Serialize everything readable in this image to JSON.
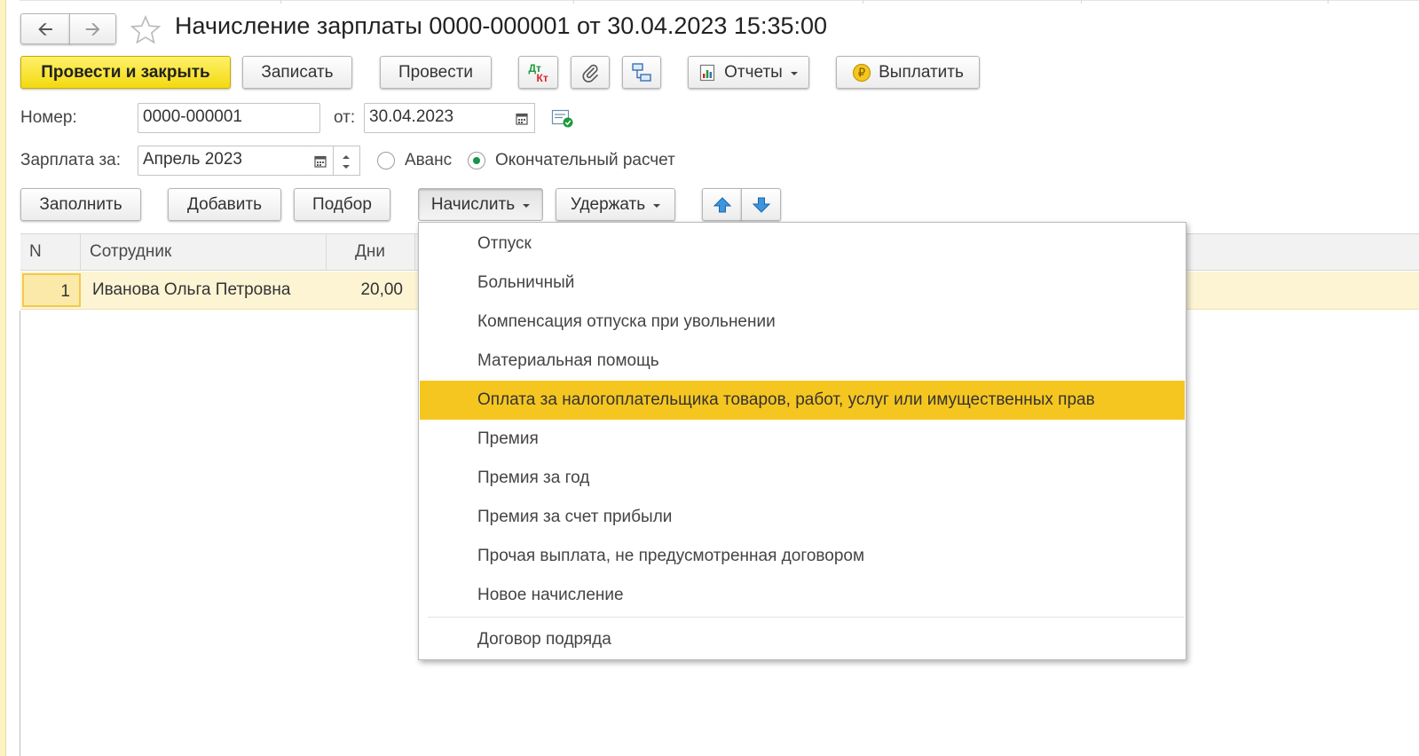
{
  "window": {
    "title": "Начисление зарплаты 0000-000001 от 30.04.2023 15:35:00"
  },
  "nav": {
    "back_icon": "arrow-left-icon",
    "forward_icon": "arrow-right-icon",
    "favorite_icon": "star-icon"
  },
  "toolbar": {
    "post_and_close": "Провести и закрыть",
    "save": "Записать",
    "post": "Провести",
    "dt_kt_top": "Дт",
    "dt_kt_bottom": "Кт",
    "attach_icon": "paperclip-icon",
    "structure_icon": "structure-icon",
    "reports": "Отчеты",
    "pay": "Выплатить"
  },
  "form": {
    "number_label": "Номер:",
    "number_value": "0000-000001",
    "date_label": "от:",
    "date_value": "30.04.2023",
    "salary_for_label": "Зарплата за:",
    "salary_for_value": "Апрель 2023",
    "radio_advance": "Аванс",
    "radio_final": "Окончательный расчет",
    "selected_radio": "Окончательный расчет"
  },
  "table_toolbar": {
    "fill": "Заполнить",
    "add": "Добавить",
    "pick": "Подбор",
    "accrue": "Начислить",
    "withhold": "Удержать"
  },
  "table": {
    "columns": [
      "N",
      "Сотрудник",
      "Дни"
    ],
    "rows": [
      {
        "n": "1",
        "employee": "Иванова Ольга Петровна",
        "days": "20,00"
      }
    ]
  },
  "accrue_menu": {
    "items": [
      "Отпуск",
      "Больничный",
      "Компенсация отпуска при увольнении",
      "Материальная помощь",
      "Оплата за налогоплательщика товаров, работ, услуг или имущественных прав",
      "Премия",
      "Премия за год",
      "Премия за счет прибыли",
      "Прочая выплата, не предусмотренная договором",
      "Новое начисление"
    ],
    "after_separator": "Договор подряда",
    "highlighted": "Оплата за налогоплательщика товаров, работ, услуг или имущественных прав"
  },
  "colors": {
    "primary_button": "#f3d90f",
    "menu_highlight": "#f6c620",
    "row_selected": "#fdf4d4",
    "radio_selected": "#149748"
  }
}
